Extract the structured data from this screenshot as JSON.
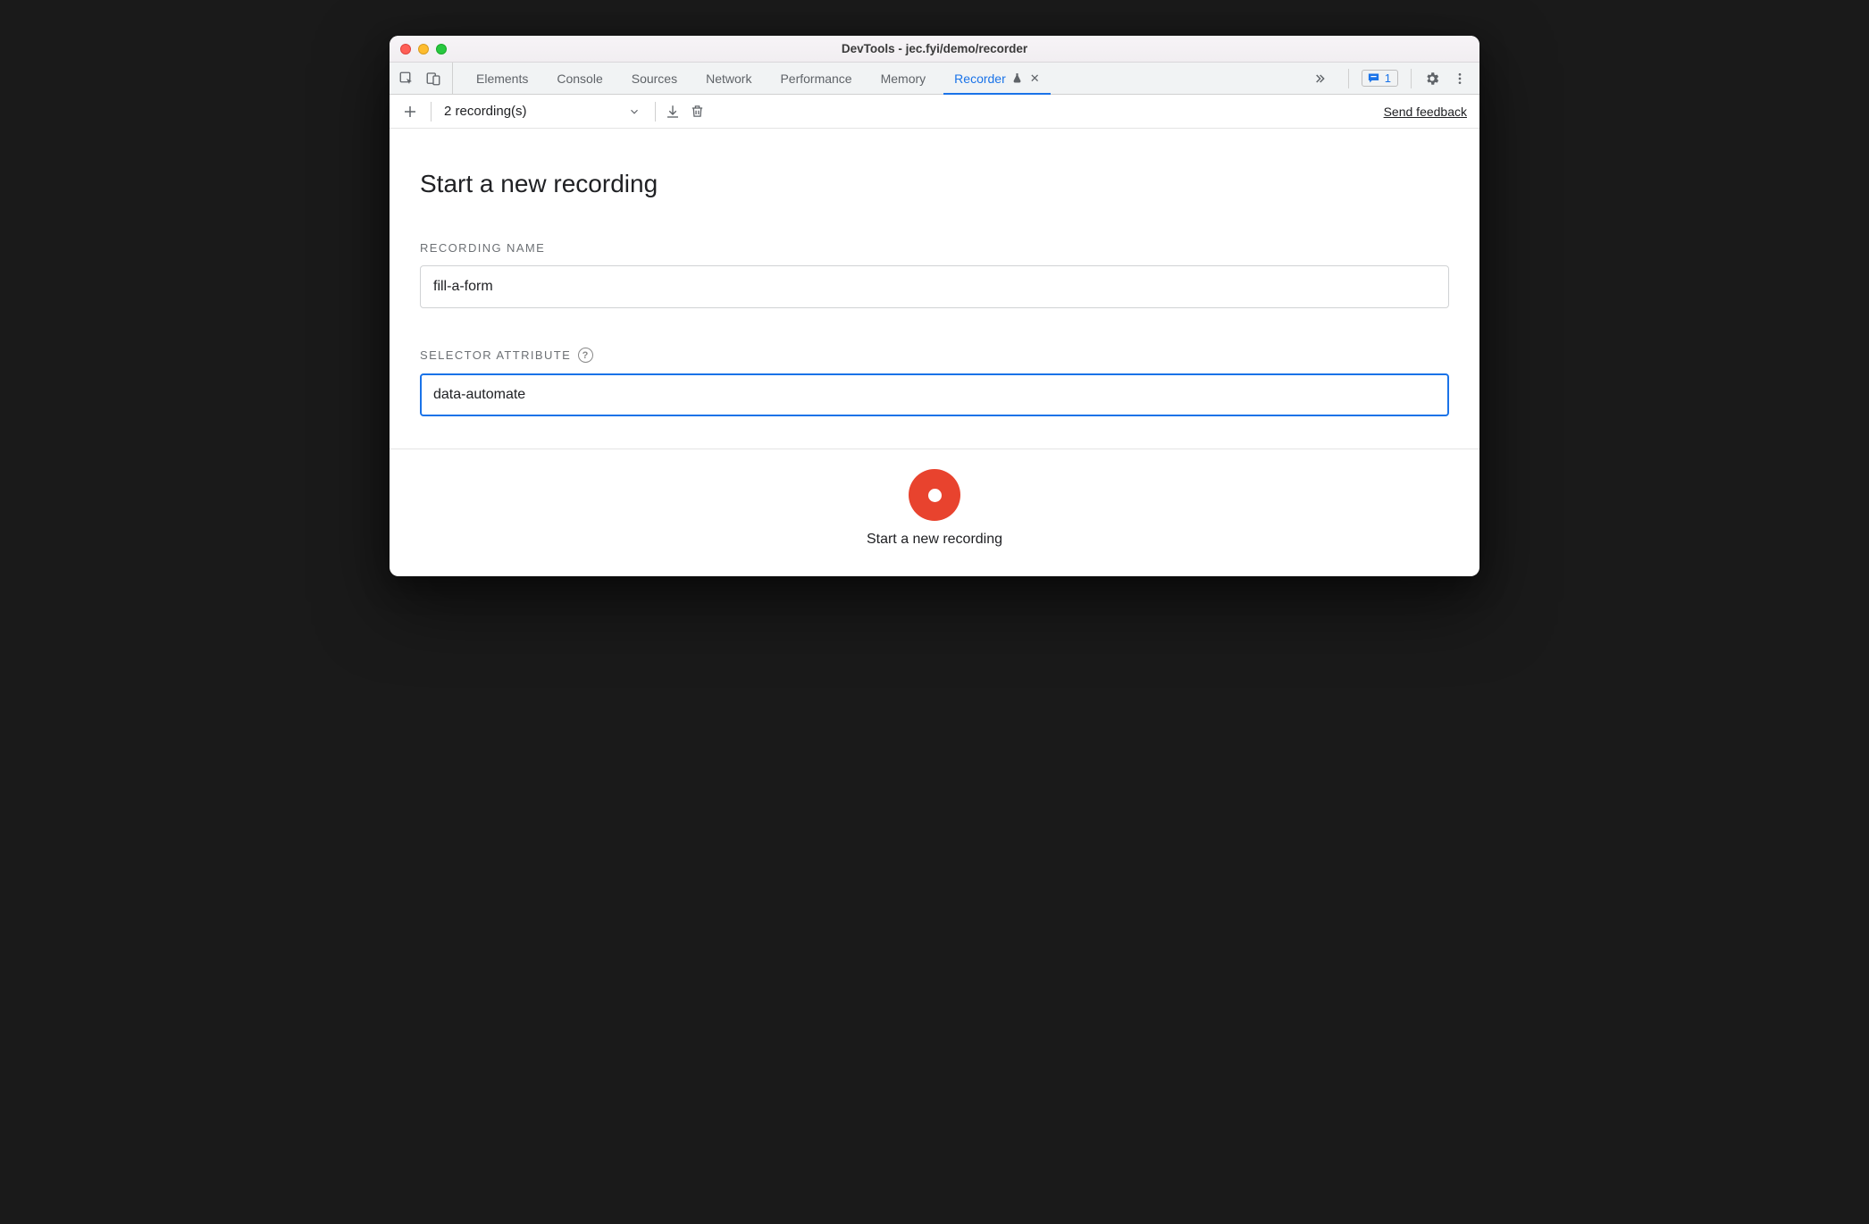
{
  "window": {
    "title": "DevTools - jec.fyi/demo/recorder"
  },
  "tabstrip": {
    "tabs": [
      {
        "label": "Elements",
        "active": false
      },
      {
        "label": "Console",
        "active": false
      },
      {
        "label": "Sources",
        "active": false
      },
      {
        "label": "Network",
        "active": false
      },
      {
        "label": "Performance",
        "active": false
      },
      {
        "label": "Memory",
        "active": false
      },
      {
        "label": "Recorder",
        "active": true,
        "experimental": true,
        "closable": true
      }
    ],
    "issues_count": "1"
  },
  "toolbar": {
    "recordings_summary": "2 recording(s)",
    "feedback_link": "Send feedback"
  },
  "main": {
    "heading": "Start a new recording",
    "recording_name_label": "Recording Name",
    "recording_name_value": "fill-a-form",
    "selector_attr_label": "Selector Attribute",
    "selector_attr_value": "data-automate"
  },
  "footer": {
    "record_label": "Start a new recording"
  }
}
